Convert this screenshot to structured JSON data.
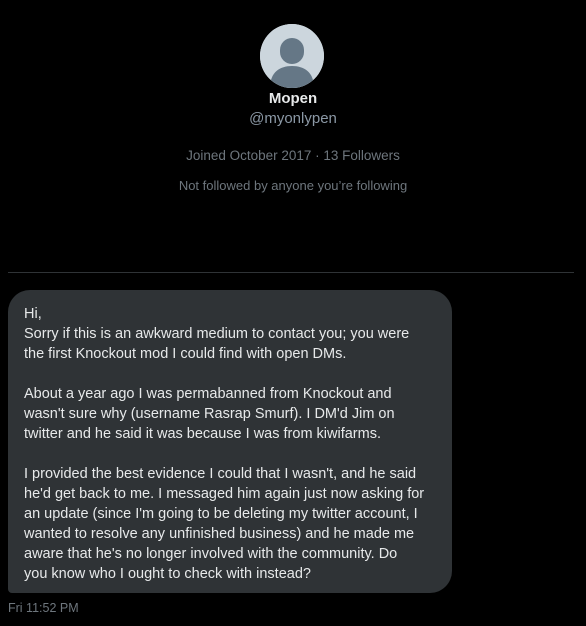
{
  "profile": {
    "name": "Mopen",
    "handle": "@myonlypen",
    "joined": "Joined October 2017 · 13 Followers",
    "followed_status": "Not followed by anyone you’re following",
    "avatar_icon": "default-user-icon"
  },
  "message": {
    "lines_block1": [
      "Hi,",
      "Sorry if this is an awkward medium to contact you; you were",
      "the first Knockout mod I could find with open DMs."
    ],
    "lines_block2": [
      "About a year ago I was permabanned from Knockout and",
      "wasn't sure why (username Rasrap Smurf). I DM'd Jim on",
      "twitter and he said it was because I was from kiwifarms."
    ],
    "lines_block3": [
      "I provided the best evidence I could that I wasn't, and he said",
      "he'd get back to me. I messaged him again just now asking for",
      "an update (since I'm going to be deleting my twitter account, I",
      "wanted to resolve any unfinished business) and he made me",
      "aware that he's no longer involved with the community. Do",
      "you know who I ought to check with instead?"
    ],
    "timestamp": "Fri 11:52 PM"
  },
  "colors": {
    "background": "#000000",
    "bubble": "#2f3336",
    "primary_text": "#e7e9ea",
    "secondary_text": "#6e767d"
  }
}
